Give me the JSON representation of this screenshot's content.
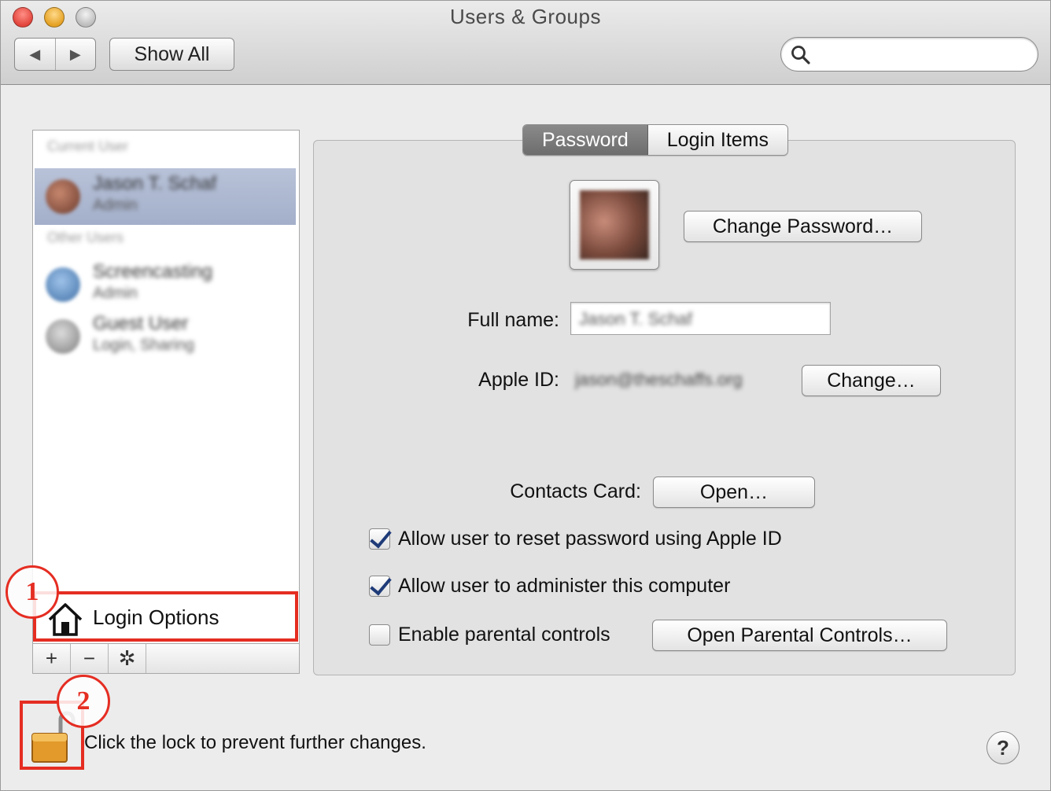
{
  "window": {
    "title": "Users & Groups"
  },
  "toolbar": {
    "back_glyph": "◀",
    "forward_glyph": "▶",
    "show_all_label": "Show All",
    "search_placeholder": ""
  },
  "sidebar": {
    "current_user_heading": "Current User",
    "current_user": {
      "name": "Jason T. Schaf",
      "role": "Admin"
    },
    "other_users_heading": "Other Users",
    "other_users": [
      {
        "name": "Screencasting",
        "role": "Admin"
      },
      {
        "name": "Guest User",
        "role": "Login, Sharing"
      }
    ],
    "login_options_label": "Login Options",
    "buttons": {
      "add": "+",
      "remove": "−",
      "action": "✲"
    }
  },
  "tabs": [
    {
      "label": "Password",
      "active": true
    },
    {
      "label": "Login Items",
      "active": false
    }
  ],
  "account": {
    "change_password_label": "Change Password…",
    "full_name_label": "Full name:",
    "full_name_value": "Jason T. Schaf",
    "apple_id_label": "Apple ID:",
    "apple_id_value": "jason@theschaffs.org",
    "change_apple_id_label": "Change…",
    "contacts_card_label": "Contacts Card:",
    "open_contacts_label": "Open…"
  },
  "options": [
    {
      "label": "Allow user to reset password using Apple ID",
      "checked": true
    },
    {
      "label": "Allow user to administer this computer",
      "checked": true
    },
    {
      "label": "Enable parental controls",
      "checked": false
    }
  ],
  "open_parental_controls_label": "Open Parental Controls…",
  "footer": {
    "lock_text": "Click the lock to prevent further changes.",
    "help_label": "?"
  },
  "annotations": [
    {
      "number": "1"
    },
    {
      "number": "2"
    }
  ],
  "colors": {
    "annotation": "#e52d22",
    "selection": "#a3afca",
    "checkmark": "#1f3b78"
  }
}
